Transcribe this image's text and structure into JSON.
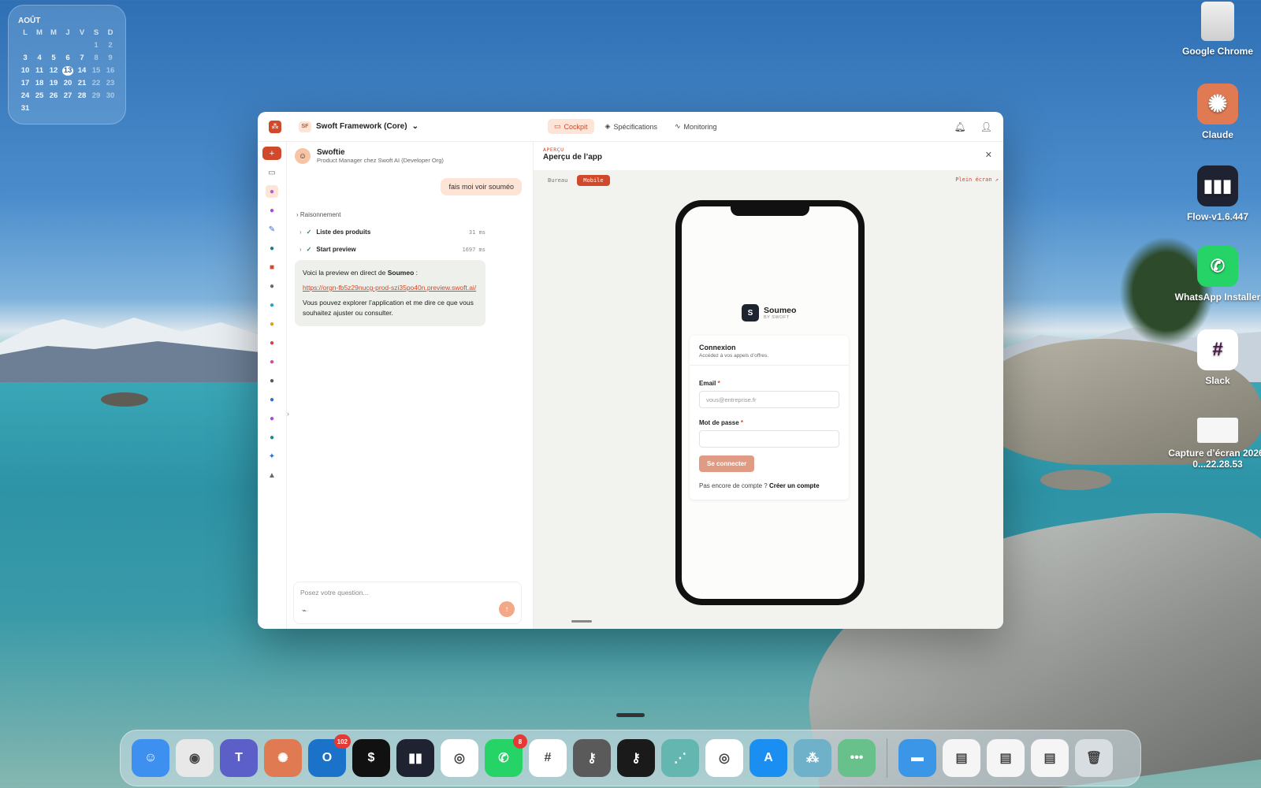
{
  "calendar": {
    "month": "AOÛT",
    "weekdays": [
      "L",
      "M",
      "M",
      "J",
      "V",
      "S",
      "D"
    ],
    "weeks": [
      [
        "",
        "",
        "",
        "",
        "",
        "1",
        "2"
      ],
      [
        "3",
        "4",
        "5",
        "6",
        "7",
        "8",
        "9"
      ],
      [
        "10",
        "11",
        "12",
        "13",
        "14",
        "15",
        "16"
      ],
      [
        "17",
        "18",
        "19",
        "20",
        "21",
        "22",
        "23"
      ],
      [
        "24",
        "25",
        "26",
        "27",
        "28",
        "29",
        "30"
      ],
      [
        "31",
        "",
        "",
        "",
        "",
        "",
        ""
      ]
    ],
    "today": "13"
  },
  "desktop_icons": [
    {
      "label": "Google Chrome",
      "icon": "chrome-disk-icon"
    },
    {
      "label": "Claude",
      "icon": "claude-icon",
      "color": "#e07a52"
    },
    {
      "label": "Flow-v1.6.447",
      "icon": "flow-icon",
      "color": "#1f2230"
    },
    {
      "label": "WhatsApp Installer",
      "icon": "whatsapp-icon",
      "color": "#25d366"
    },
    {
      "label": "Slack",
      "icon": "slack-icon"
    },
    {
      "label": "Capture d’écran 2026-0...22.28.53",
      "icon": "screenshot-file-icon"
    }
  ],
  "app": {
    "logo_glyph": "⁂",
    "project_badge": "SF",
    "project_name": "Swoft Framework (Core)",
    "tabs": [
      {
        "label": "Cockpit",
        "icon": "chat-icon",
        "active": true
      },
      {
        "label": "Spécifications",
        "icon": "layers-icon",
        "active": false
      },
      {
        "label": "Monitoring",
        "icon": "activity-icon",
        "active": false
      }
    ],
    "accent": "#d2482a"
  },
  "chat": {
    "agent_name": "Swoftie",
    "agent_role": "Product Manager chez Swoft AI (Developer Org)",
    "user_message": "fais moi voir souméo",
    "reasoning_label": "Raisonnement",
    "steps": [
      {
        "label": "Liste des produits",
        "duration": "31 ms"
      },
      {
        "label": "Start preview",
        "duration": "1697 ms"
      }
    ],
    "answer_intro": "Voici la preview en direct de ",
    "answer_app": "Soumeo",
    "answer_colon": " :",
    "answer_link": "https://orgn-fb5z29nucg-prod-szi35po40n.preview.swoft.ai/",
    "answer_outro": "Vous pouvez explorer l’application et me dire ce que vous souhaitez ajuster ou consulter.",
    "composer_placeholder": "Posez votre question..."
  },
  "preview": {
    "kicker": "APERÇU",
    "title": "Aperçu de l’app",
    "toggle": [
      {
        "label": "Bureau",
        "active": false
      },
      {
        "label": "Mobile",
        "active": true
      }
    ],
    "fullscreen": "Plein écran ↗",
    "phone": {
      "logo_letter": "S",
      "app_name": "Soumeo",
      "by_line": "BY SWOFT",
      "card_title": "Connexion",
      "card_subtitle": "Accédez à vos appels d’offres.",
      "email_label": "Email",
      "email_placeholder": "vous@entreprise.fr",
      "password_label": "Mot de passe",
      "required_mark": "*",
      "submit": "Se connecter",
      "signup_prompt": "Pas encore de compte ? ",
      "signup_link": "Créer un compte"
    }
  },
  "dock": {
    "apps": [
      {
        "name": "Finder",
        "icon": "finder-icon",
        "color": "#3d8ff0"
      },
      {
        "name": "Screenshot",
        "icon": "camera-icon",
        "color": "#e8e8e8"
      },
      {
        "name": "Teams",
        "icon": "teams-icon",
        "color": "#5b5fc7"
      },
      {
        "name": "Claude",
        "icon": "claude-icon",
        "color": "#e07a52"
      },
      {
        "name": "Outlook",
        "icon": "outlook-icon",
        "color": "#1a73c9",
        "badge": "102"
      },
      {
        "name": "Terminal",
        "icon": "terminal-icon",
        "color": "#111111"
      },
      {
        "name": "Flow",
        "icon": "flow-icon",
        "color": "#1f2230"
      },
      {
        "name": "Chrome",
        "icon": "chrome-icon",
        "color": "#ffffff"
      },
      {
        "name": "WhatsApp",
        "icon": "whatsapp-icon",
        "color": "#25d366",
        "badge": "8"
      },
      {
        "name": "Slack",
        "icon": "slack-icon",
        "color": "#ffffff"
      },
      {
        "name": "Keychain",
        "icon": "keys-icon",
        "color": "#5a5a5a"
      },
      {
        "name": "Keys",
        "icon": "keys-color-icon",
        "color": "#1a1a1a"
      },
      {
        "name": "Dots App",
        "icon": "dots-icon",
        "color": "#64b7b0"
      },
      {
        "name": "Chrome Beta",
        "icon": "chrome-icon",
        "color": "#ffffff"
      },
      {
        "name": "App Store",
        "icon": "appstore-icon",
        "color": "#1b8ef2"
      },
      {
        "name": "Swoft",
        "icon": "swoft-icon",
        "color": "#6fb1c9"
      },
      {
        "name": "More",
        "icon": "ellipsis-icon",
        "color": "#68c08a"
      }
    ],
    "right": [
      {
        "name": "Folder",
        "icon": "folder-icon",
        "color": "#3b96e8"
      },
      {
        "name": "Window 1",
        "icon": "window-thumb-icon",
        "color": "#f5f5f5"
      },
      {
        "name": "Window 2",
        "icon": "window-thumb-icon",
        "color": "#f5f5f5"
      },
      {
        "name": "Window 3",
        "icon": "window-thumb-icon",
        "color": "#f5f5f5"
      },
      {
        "name": "Trash",
        "icon": "trash-icon",
        "color": "#d8dde2"
      }
    ]
  }
}
